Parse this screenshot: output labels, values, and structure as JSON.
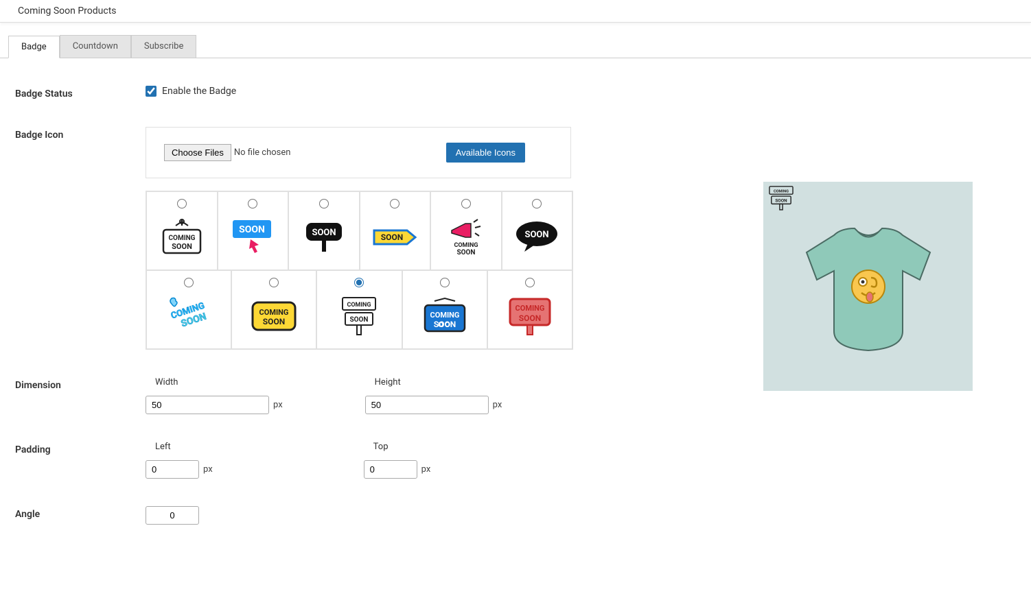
{
  "header": {
    "title": "Coming Soon Products"
  },
  "tabs": {
    "badge": "Badge",
    "countdown": "Countdown",
    "subscribe": "Subscribe"
  },
  "fields": {
    "status_label": "Badge Status",
    "enable_label": "Enable the Badge",
    "enable_checked": true,
    "icon_label": "Badge Icon",
    "choose_files": "Choose Files",
    "no_file": "No file chosen",
    "available_icons": "Available Icons",
    "selected_icon_index": 8,
    "dimension_label": "Dimension",
    "width_label": "Width",
    "height_label": "Height",
    "width_value": "50",
    "height_value": "50",
    "px_unit": "px",
    "padding_label": "Padding",
    "left_label": "Left",
    "top_label": "Top",
    "left_value": "0",
    "top_value": "0",
    "angle_label": "Angle",
    "angle_value": "0"
  }
}
